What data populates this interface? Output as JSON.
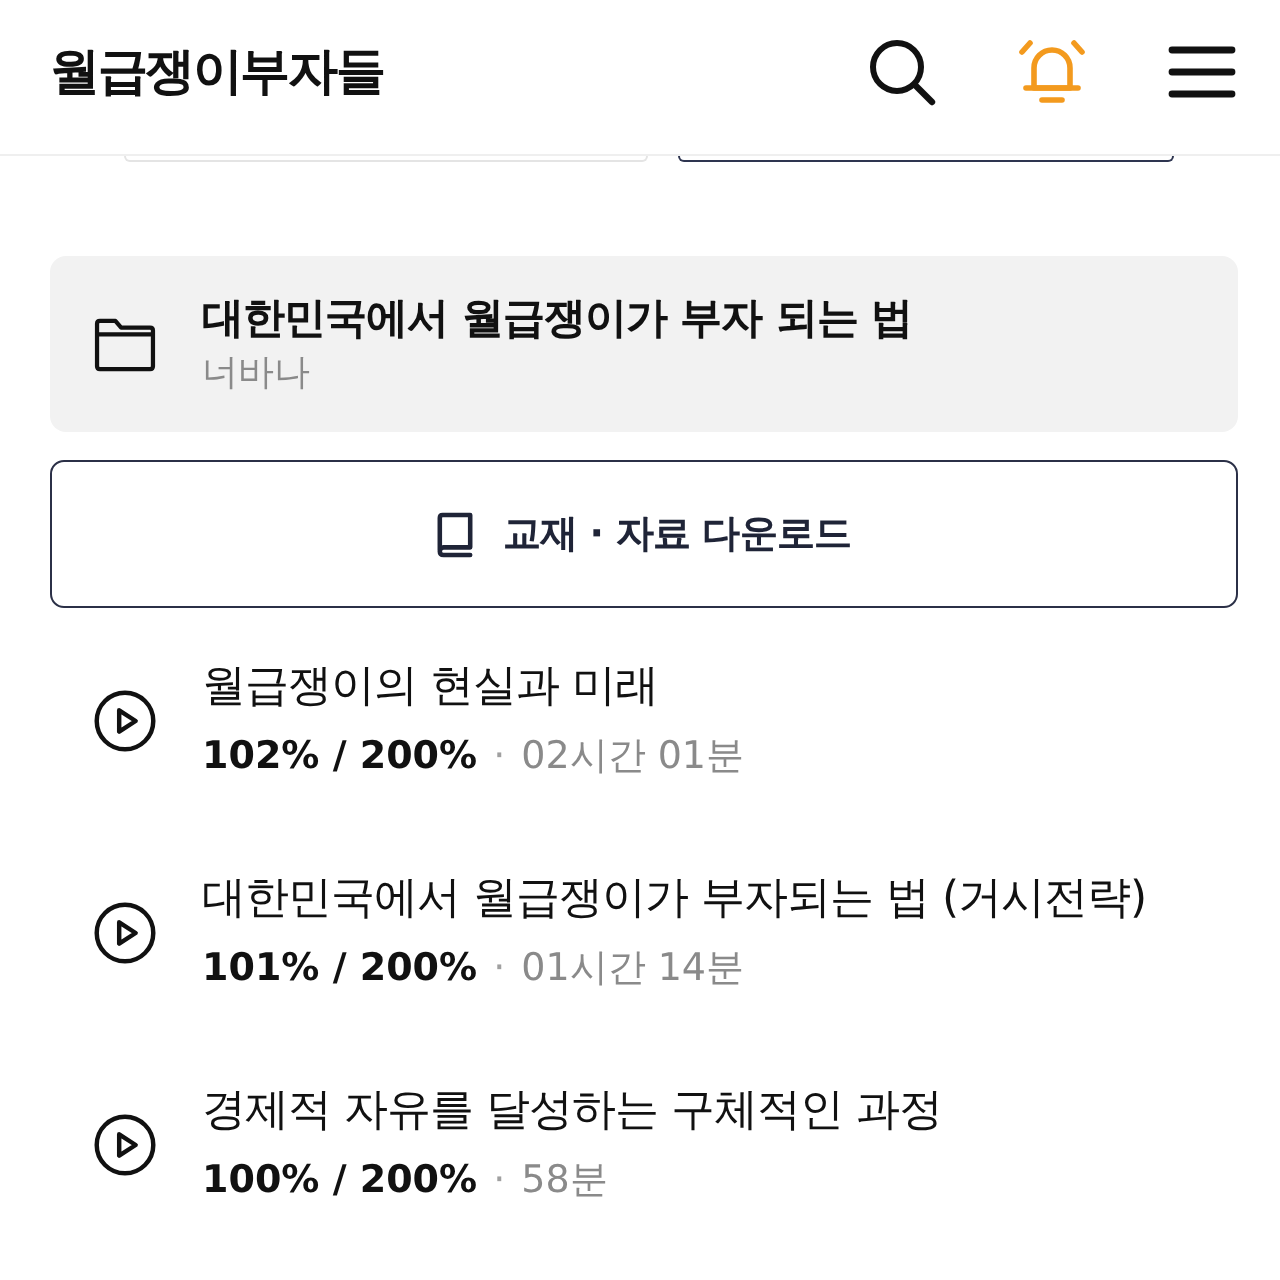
{
  "header": {
    "logo": "월급쟁이부자들",
    "has_notifications": true
  },
  "partial_buttons": [
    {
      "selected": false
    },
    {
      "selected": true
    }
  ],
  "course": {
    "title": "대한민국에서 월급쟁이가 부자 되는 법",
    "author": "너바나"
  },
  "download_button": {
    "label": "교재 · 자료 다운로드"
  },
  "lessons": [
    {
      "title": "월급쟁이의 현실과 미래",
      "progress": "102% / 200%",
      "separator": "·",
      "duration": "02시간 01분"
    },
    {
      "title": "대한민국에서 월급쟁이가 부자되는 법 (거시전략)",
      "progress": "101% / 200%",
      "separator": "·",
      "duration": "01시간 14분"
    },
    {
      "title": "경제적 자유를 달성하는 구체적인 과정",
      "progress": "100% / 200%",
      "separator": "·",
      "duration": "58분"
    }
  ]
}
